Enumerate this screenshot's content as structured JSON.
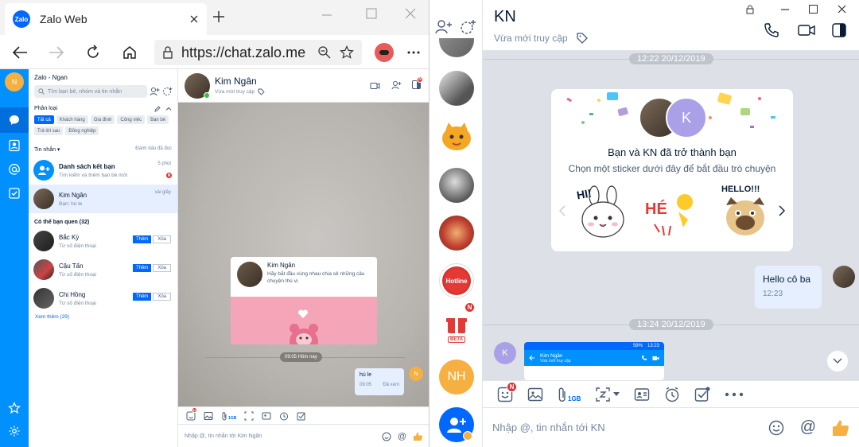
{
  "browser": {
    "tab_title": "Zalo Web",
    "url": "https://chat.zalo.me",
    "favicon_text": "Zalo"
  },
  "web": {
    "avatar_letter": "N",
    "account": "Zalo - Ngan",
    "search_placeholder": "Tìm bạn bè, nhóm và tin nhắn",
    "filter_title": "Phân loại",
    "chips": [
      "Tất cả",
      "Khách hàng",
      "Gia đình",
      "Công việc",
      "Bạn bè",
      "Trả lời sau",
      "Đồng nghiệp"
    ],
    "messages_label": "Tin nhắn ▾",
    "mark_read": "Đánh dấu đã đọc",
    "convs": [
      {
        "name": "Danh sách kết bạn",
        "preview": "Tìm kiếm và thêm bạn bè mới",
        "time": "5 phút"
      },
      {
        "name": "Kim Ngân",
        "preview": "Bạn: hú le",
        "time": "vài giây"
      }
    ],
    "maybe_know": "Có thể bạn quen (32)",
    "suggestions": [
      {
        "name": "Bắc Kỳ",
        "sub": "Từ số điện thoại"
      },
      {
        "name": "Cậu Tấn",
        "sub": "Từ số điện thoại"
      },
      {
        "name": "Chị Hồng",
        "sub": "Từ số điện thoại"
      }
    ],
    "add_label": "Thêm",
    "remove_label": "Xóa",
    "see_more": "Xem thêm (29)",
    "chat": {
      "name": "Kim Ngân",
      "status": "Vừa mới truy cập",
      "intro_name": "Kim Ngân",
      "intro_text": "Hãy bắt đầu cùng nhau chia sẻ những câu chuyện thú vị",
      "date_tag": "09:05 Hôm nay",
      "msg_text": "hú le",
      "msg_time": "09:05",
      "msg_status": "Đã xem",
      "file_size": "1GB",
      "input_placeholder": "Nhập @, tin nhắn tới Kim Ngân"
    }
  },
  "app": {
    "title": "KN",
    "status": "Vừa mới truy cập",
    "rail_hotline": "Hotline",
    "rail_beta": "BETA",
    "rail_initials": "NH",
    "badge": "N",
    "ts1": "12:22 20/12/2019",
    "ts2": "13:24 20/12/2019",
    "card_letter": "K",
    "card_title": "Bạn và KN đã trở thành bạn",
    "card_sub": "Chọn một sticker dưới đây để bắt đầu trò chuyện",
    "stickers": [
      "HI!",
      "HÉ",
      "HELLO!!!"
    ],
    "msg_text": "Hello cô ba",
    "msg_time": "12:23",
    "preview_name": "Kim Ngân",
    "preview_status": "Vừa mới truy cập",
    "preview_time": "13:23",
    "preview_battery": "59%",
    "sender_letter": "K",
    "file_size": "1GB",
    "input_placeholder": "Nhập @, tin nhắn tới KN"
  },
  "colors": {
    "zalo_blue": "#0091ff",
    "primary": "#0068ff",
    "bubble": "#e5efff",
    "alert": "#e03131"
  }
}
